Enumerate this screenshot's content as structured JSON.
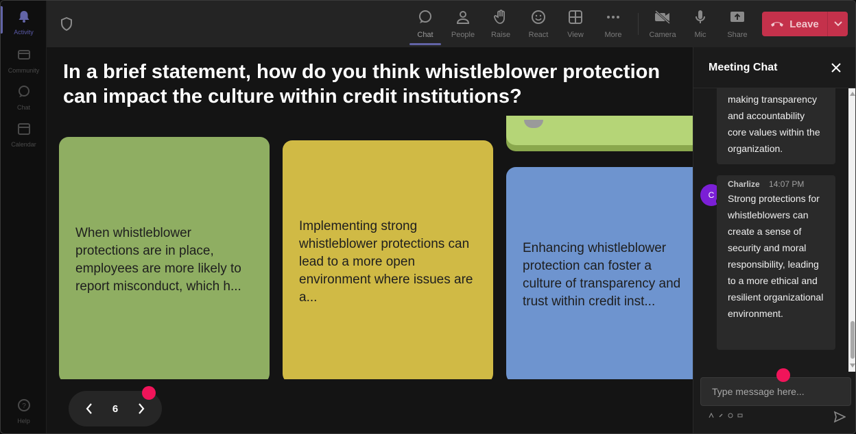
{
  "rail": {
    "items": [
      {
        "label": "Activity",
        "icon": "bell-icon",
        "active": true
      },
      {
        "label": "Community",
        "icon": "community-icon"
      },
      {
        "label": "Chat",
        "icon": "chat-icon"
      },
      {
        "label": "Calendar",
        "icon": "calendar-icon"
      }
    ],
    "help": {
      "label": "Help",
      "icon": "help-icon"
    }
  },
  "toolbar": {
    "buttons": [
      {
        "label": "Chat",
        "icon": "chat-icon",
        "active": true
      },
      {
        "label": "People",
        "icon": "people-icon"
      },
      {
        "label": "Raise",
        "icon": "raise-hand-icon"
      },
      {
        "label": "React",
        "icon": "react-emoji-icon"
      },
      {
        "label": "View",
        "icon": "view-grid-icon"
      },
      {
        "label": "More",
        "icon": "more-dots-icon"
      },
      {
        "label": "Camera",
        "icon": "camera-off-icon"
      },
      {
        "label": "Mic",
        "icon": "mic-icon"
      },
      {
        "label": "Share",
        "icon": "share-screen-icon"
      }
    ],
    "leave_label": "Leave",
    "leave_color": "#c4314b"
  },
  "stage": {
    "question": "In a brief statement, how do you think whistleblower protection can impact the culture within credit institutions?",
    "cards": [
      {
        "text": "When whistleblower protections are in place, employees are more likely to report misconduct, which h...",
        "color": "#8fae62"
      },
      {
        "text": "Implementing strong whistleblower protections can lead to a more open environment where issues are a...",
        "color": "#d0ba45"
      },
      {
        "text": "Enhancing whistleblower protection can foster a culture of transparency and trust within credit inst...",
        "color": "#6e94cf"
      }
    ],
    "page_number": "6"
  },
  "chat": {
    "title": "Meeting Chat",
    "messages": [
      {
        "author": "",
        "time": "",
        "text": "making transparency and accountability core values within the organization."
      },
      {
        "author": "Charlize",
        "avatar_initial": "C",
        "time": "14:07 PM",
        "text": "Strong protections for whistleblowers can create a sense of security and moral responsibility, leading to a more ethical and resilient organizational environment."
      }
    ],
    "input_placeholder": "Type message here...",
    "avatar_color": "#7b1fd6"
  },
  "accent": "#6264a7",
  "marker_color": "#f0145a"
}
